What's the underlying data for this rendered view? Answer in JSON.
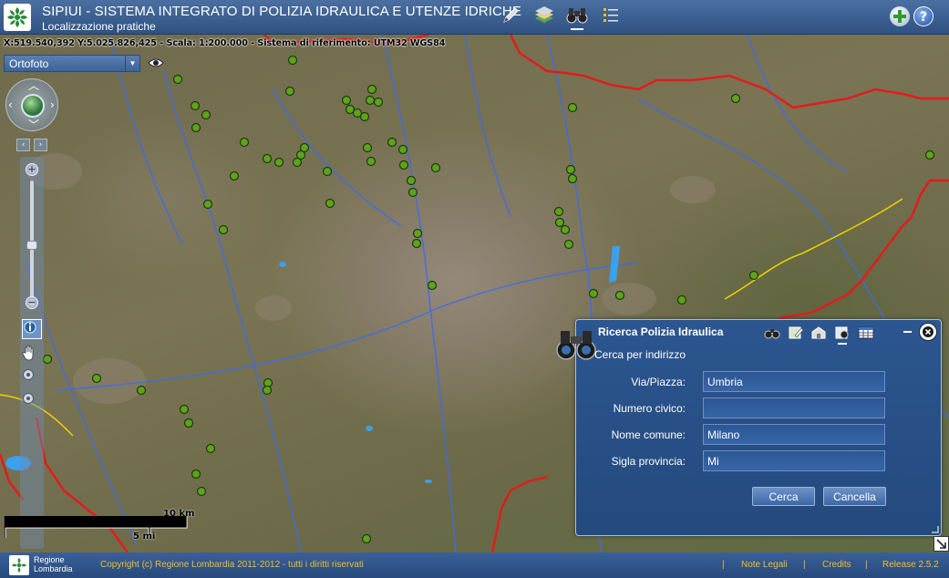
{
  "header": {
    "title": "SIPIUI - SISTEMA INTEGRATO DI POLIZIA IDRAULICA E UTENZE IDRICHE",
    "subtitle": "Localizzazione pratiche",
    "tools": [
      "pencil-icon",
      "layers-icon",
      "binoculars-icon",
      "list-icon"
    ],
    "active_tool": "binoculars-icon",
    "right_buttons": [
      "add-icon",
      "help-icon"
    ]
  },
  "map": {
    "coords_text": "X:519.540,392 Y:5.025.826,425 - Scala: 1:200.000 - Sistema di riferimento: UTM32 WGS84",
    "layer_select": "Ortofoto",
    "scale_km": "10 km",
    "scale_mi": "5 mi"
  },
  "colors": {
    "header_bg": "#2f5282",
    "boundary": "#e21c1c",
    "rivers": "#3a6cf0",
    "points": "#5ea21e",
    "footer_text": "#f0c020"
  },
  "panel": {
    "title": "Ricerca Polizia Idraulica",
    "mode": "Cerca per indirizzo",
    "fields": [
      {
        "label": "Via/Piazza:",
        "value": "Umbria"
      },
      {
        "label": "Numero civico:",
        "value": ""
      },
      {
        "label": "Nome comune:",
        "value": "Milano"
      },
      {
        "label": "Sigla provincia:",
        "value": "Mi"
      }
    ],
    "search_btn": "Cerca",
    "cancel_btn": "Cancella"
  },
  "footer": {
    "brand_line1": "Regione",
    "brand_line2": "Lombardia",
    "copyright": "Copyright (c) Regione Lombardia 2011-2012 - tutti i diritti riservati",
    "links": [
      "Note Legali",
      "Credits",
      "Release 2.5.2"
    ]
  }
}
